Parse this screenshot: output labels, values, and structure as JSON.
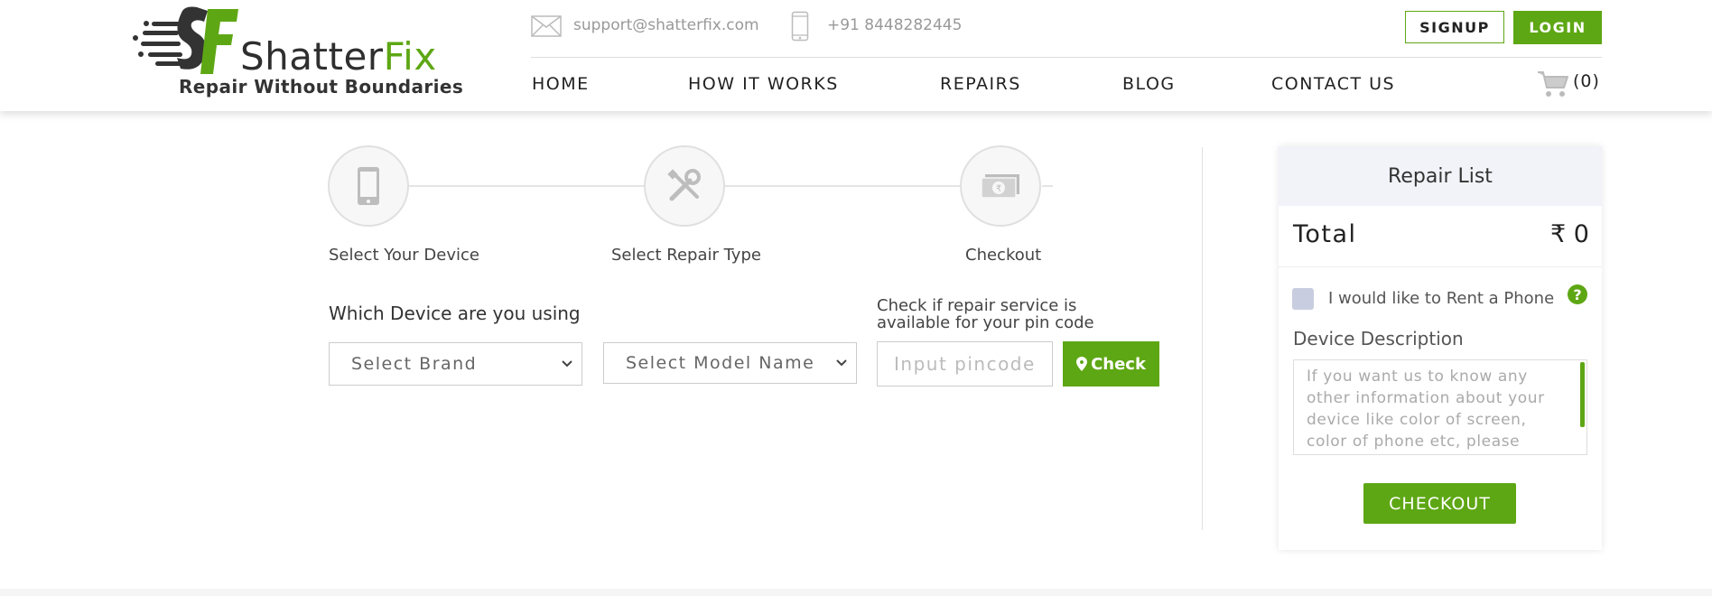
{
  "header": {
    "brand_shatter": "Shatter",
    "brand_fix": "Fix",
    "tagline": "Repair Without Boundaries",
    "email": "support@shatterfix.com",
    "phone": "+91 8448282445",
    "signup_label": "SIGNUP",
    "login_label": "LOGIN",
    "nav": [
      {
        "label": "HOME"
      },
      {
        "label": "HOW IT WORKS"
      },
      {
        "label": "REPAIRS"
      },
      {
        "label": "BLOG"
      },
      {
        "label": "CONTACT US"
      }
    ],
    "cart_count": "(0)"
  },
  "steps": [
    {
      "label": "Select Your Device",
      "icon": "smartphone-icon"
    },
    {
      "label": "Select Repair Type",
      "icon": "tools-icon"
    },
    {
      "label": "Checkout",
      "icon": "rupee-cash-icon"
    }
  ],
  "device": {
    "question": "Which Device are you using",
    "brand_select": "Select Brand",
    "model_select": "Select Model Name",
    "pin_hint": "Check if repair service is available for your pin code",
    "pin_placeholder": "Input pincode",
    "check_label": "Check"
  },
  "repair_list": {
    "title": "Repair List",
    "total_label": "Total",
    "total_value": "₹ 0",
    "rent_label": "I would like to Rent a Phone",
    "help": "?",
    "desc_label": "Device Description",
    "desc_placeholder": "If you want us to know any other information about your device like color of screen, color of phone etc, please",
    "checkout_label": "CHECKOUT"
  },
  "colors": {
    "accent": "#5ea714",
    "text": "#333333",
    "muted": "#999999"
  }
}
